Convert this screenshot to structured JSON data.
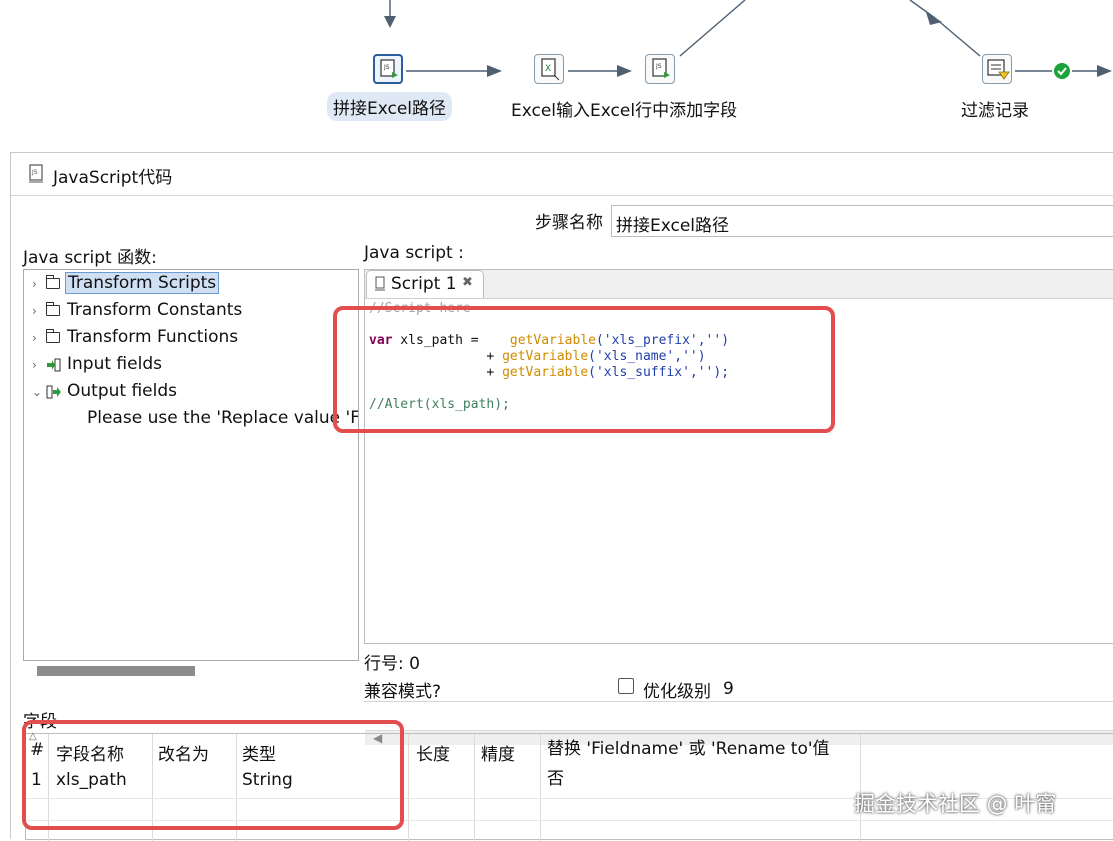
{
  "canvas": {
    "nodes": [
      {
        "label": "拼接Excel路径",
        "selected": true
      },
      {
        "label": "Excel输入Excel行中添加字段"
      },
      {
        "label": "过滤记录"
      }
    ]
  },
  "dialog": {
    "title": "JavaScript代码",
    "step_name_label": "步骤名称",
    "step_name_value": "拼接Excel路径",
    "functions_label": "Java script 函数:",
    "script_label": "Java script :",
    "tree": [
      {
        "label": "Transform Scripts",
        "icon": "folder-icon",
        "expanded": false,
        "selected": true
      },
      {
        "label": "Transform Constants",
        "icon": "folder-icon",
        "expanded": false
      },
      {
        "label": "Transform Functions",
        "icon": "folder-icon",
        "expanded": false
      },
      {
        "label": "Input fields",
        "icon": "input-fields-icon",
        "expanded": false
      },
      {
        "label": "Output fields",
        "icon": "output-fields-icon",
        "expanded": true
      },
      {
        "label": "Please use the 'Replace value 'Fi"
      }
    ],
    "editor": {
      "tab_label": "Script 1",
      "code": {
        "comment_top": "//Script here",
        "l1_kw": "var",
        "l1_rest": " xls_path =    ",
        "l1_fn": "getVariable",
        "l1_args": "('xls_prefix','')",
        "l2_pre": "               + ",
        "l2_fn": "getVariable",
        "l2_args": "('xls_name','')",
        "l3_pre": "               + ",
        "l3_fn": "getVariable",
        "l3_args": "('xls_suffix','');",
        "comment_bottom": "//Alert(xls_path);"
      }
    },
    "line_number_label": "行号: 0",
    "compat_label": "兼容模式?",
    "optimize_label": "优化级别",
    "optimize_value": "9",
    "fields_label": "字段",
    "table": {
      "headers": [
        "#",
        "字段名称",
        "改名为",
        "类型",
        "长度",
        "精度",
        "替换 'Fieldname' 或 'Rename to'值否"
      ],
      "rows": [
        {
          "num": "1",
          "name": "xls_path",
          "rename": "",
          "type": "String",
          "length": "",
          "precision": "",
          "replace": ""
        }
      ]
    }
  },
  "watermark": "掘金技术社区 @ 叶甯",
  "colors": {
    "highlight_box": "#e24d4d",
    "selected_blue": "#2a5e9a",
    "ok_green": "#1aa33a"
  }
}
